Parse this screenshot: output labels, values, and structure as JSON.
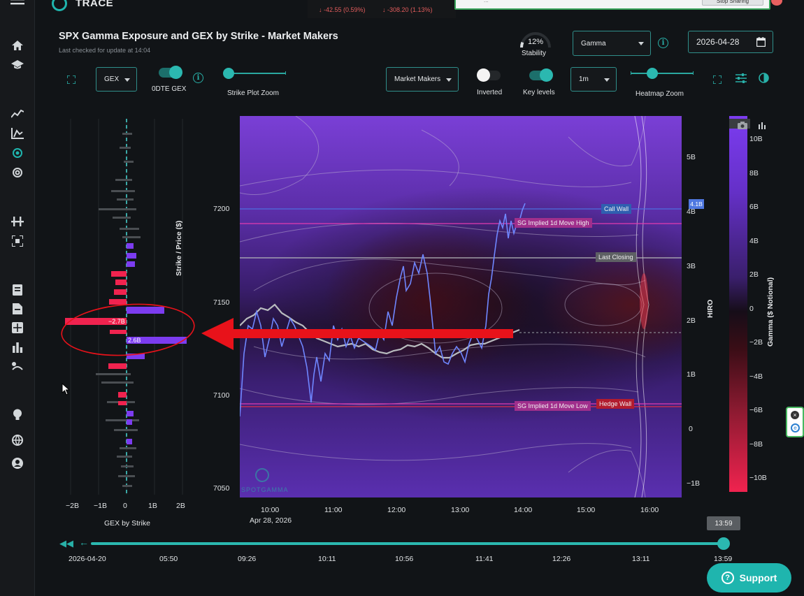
{
  "app": {
    "name": "TRACE"
  },
  "tickers": [
    {
      "text": "↓ -42.55 (0.59%)"
    },
    {
      "text": "↓ -308.20 (1.13%)"
    }
  ],
  "notification": {
    "text": "...",
    "button_label": "Stop Sharing"
  },
  "header": {
    "title": "SPX Gamma Exposure and GEX by Strike - Market Makers",
    "subtitle": "Last checked for update at 14:04",
    "stability_value": "12%",
    "stability_label": "Stability",
    "stability_fraction": 0.12,
    "gamma_select": "Gamma",
    "date": "2026-04-28"
  },
  "controls": {
    "gex_select": "GEX",
    "odte_label": "0DTE GEX",
    "strike_zoom_label": "Strike Plot Zoom",
    "market_makers_select": "Market Makers",
    "inverted_label": "Inverted",
    "key_levels_label": "Key levels",
    "interval_select": "1m",
    "heatmap_zoom_label": "Heatmap Zoom"
  },
  "gex_panel": {
    "xlabel": "GEX by Strike",
    "ticks": [
      "−2B",
      "−1B",
      "0",
      "1B",
      "2B"
    ],
    "neg_label": "−2.7B",
    "pos_label": "2.6B"
  },
  "chart_data": {
    "type": "heatmap",
    "ylabel": "Strike / Price ($)",
    "y_ticks": [
      "7200",
      "7150",
      "7100",
      "7050"
    ],
    "x_ticks": [
      "10:00",
      "11:00",
      "12:00",
      "13:00",
      "14:00",
      "15:00",
      "16:00"
    ],
    "x_date": "Apr 28, 2026",
    "hiro_label": "HIRO",
    "hiro_ticks": [
      "5B",
      "4B",
      "3B",
      "2B",
      "1B",
      "0",
      "−1B"
    ],
    "hiro_marker": "4.1B",
    "colorbar_label": "Gamma ($ Notional)",
    "colorbar_ticks": [
      "10B",
      "8B",
      "6B",
      "4B",
      "2B",
      "0",
      "−2B",
      "−4B",
      "−6B",
      "−8B",
      "−10B"
    ],
    "levels": [
      {
        "name": "Call Wall",
        "value": 7200
      },
      {
        "name": "SG Implied 1d Move High",
        "value": 7195
      },
      {
        "name": "Last Closing",
        "value": 7176
      },
      {
        "name": "SG Implied 1d Move Low",
        "value": 7096
      },
      {
        "name": "Hedge Wall",
        "value": 7096
      }
    ],
    "watermark": "SPOTGAMMA"
  },
  "timeline": {
    "current": "13:59",
    "labels": [
      "2026-04-20",
      "05:50",
      "09:26",
      "10:11",
      "10:56",
      "11:41",
      "12:26",
      "13:11",
      "13:59"
    ]
  },
  "support": {
    "label": "Support"
  },
  "colors": {
    "accent": "#1fb5ae",
    "negative": "#f0234f",
    "positive": "#7c3cf0",
    "arrow": "#e8121a"
  }
}
